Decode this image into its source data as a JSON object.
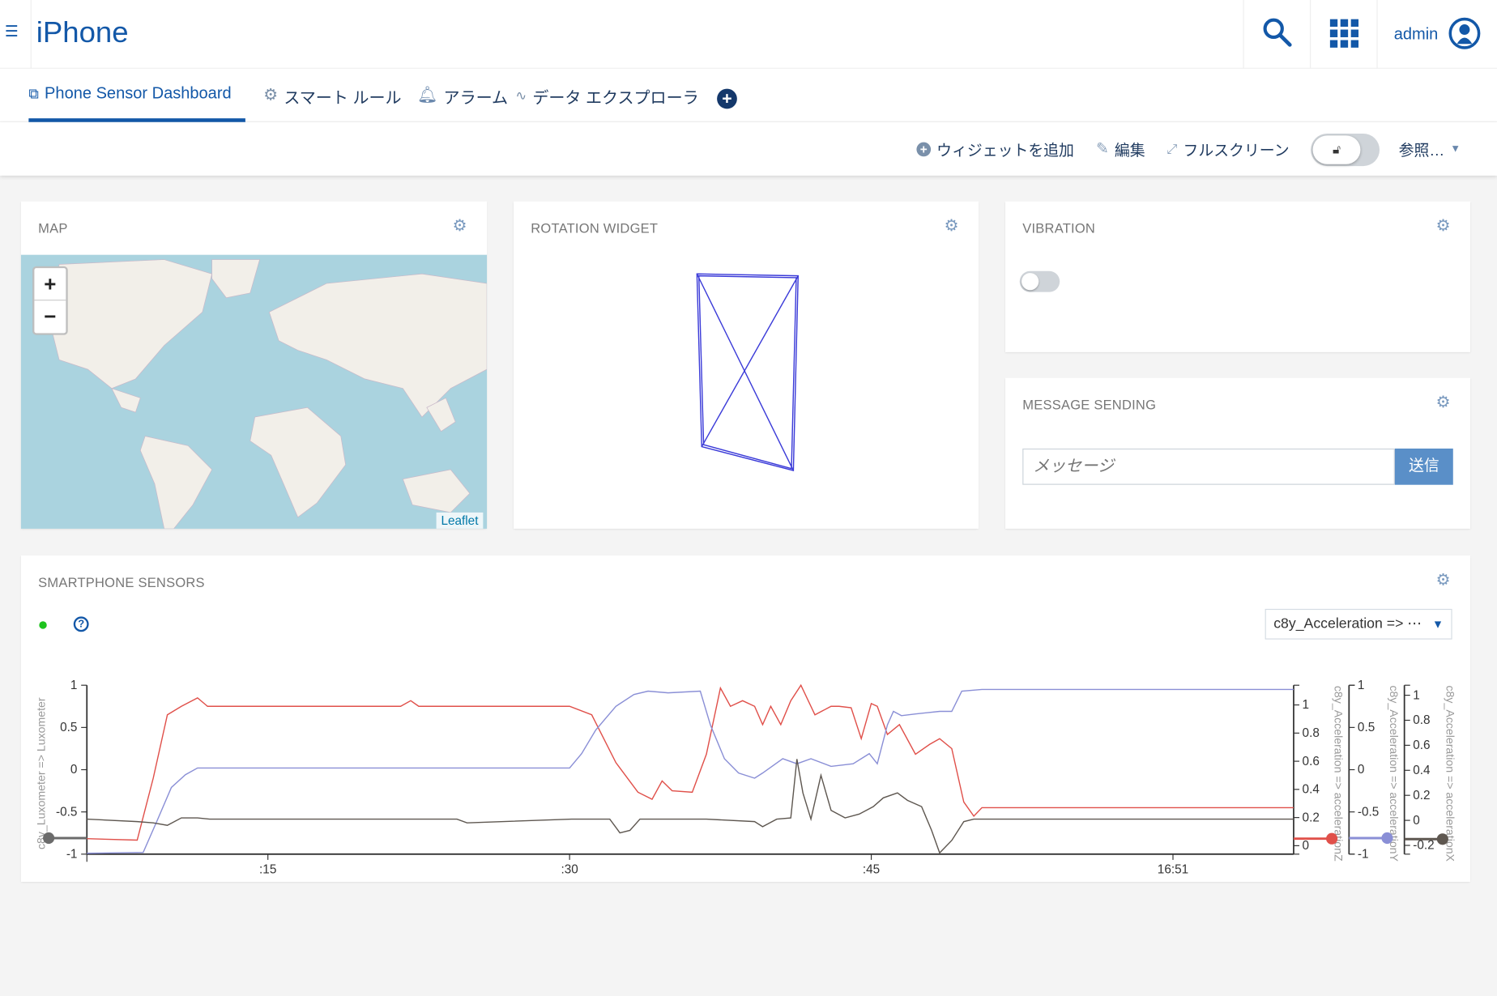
{
  "header": {
    "title": "iPhone",
    "user": "admin",
    "icons": [
      "menu-icon",
      "search-icon",
      "apps-grid-icon",
      "user-avatar-icon"
    ]
  },
  "tabs": [
    {
      "label": "Phone Sensor Dashboard",
      "icon": "devices-icon",
      "active": true
    },
    {
      "label": "スマート ルール",
      "icon": "gears-icon"
    },
    {
      "label": "アラーム",
      "icon": "bell-icon"
    },
    {
      "label": "データ エクスプローラ",
      "icon": "data-explorer-icon"
    }
  ],
  "toolbar": {
    "add_widget": "ウィジェットを追加",
    "edit": "編集",
    "fullscreen": "フルスクリーン",
    "more": "参照…",
    "lock_state": "unlocked"
  },
  "widgets": {
    "map": {
      "title": "MAP",
      "zoom_in": "+",
      "zoom_out": "−",
      "attribution": "Leaflet"
    },
    "rotation": {
      "title": "ROTATION WIDGET"
    },
    "vibration": {
      "title": "VIBRATION",
      "on": false
    },
    "message": {
      "title": "MESSAGE SENDING",
      "placeholder": "メッセージ",
      "send": "送信"
    },
    "sensors": {
      "title": "SMARTPHONE SENSORS",
      "status_color": "#1ec31e",
      "selector": "c8y_Acceleration => ⋯"
    }
  },
  "chart_data": {
    "type": "line",
    "x_ticks": [
      ":15",
      ":30",
      ":45",
      "16:51"
    ],
    "x_tick_times": [
      "16:50:15",
      "16:50:30",
      "16:50:45",
      "16:51:00"
    ],
    "xlim": [
      "16:50:06",
      "16:51:06"
    ],
    "axes": [
      {
        "id": "lux",
        "label": "c8y_Luxometer => Luxometer",
        "side": "left",
        "ylim": [
          -1,
          1
        ],
        "ticks": [
          "1",
          "0.5",
          "0",
          "-0.5",
          "-1"
        ],
        "tick_values": [
          1,
          0.5,
          0,
          -0.5,
          -1
        ],
        "marker": -0.81,
        "color": "#6b6b6b"
      },
      {
        "id": "z",
        "label": "c8y_Acceleration => accelerationZ",
        "side": "right",
        "ylim": [
          -0.06,
          1.14
        ],
        "ticks": [
          "1",
          "0.8",
          "0.6",
          "0.4",
          "0.2",
          "0"
        ],
        "tick_values": [
          1,
          0.8,
          0.6,
          0.4,
          0.2,
          0
        ],
        "marker": 0.05,
        "color": "#e0504a"
      },
      {
        "id": "y",
        "label": "c8y_Acceleration => accelerationY",
        "side": "right",
        "ylim": [
          -1,
          1
        ],
        "ticks": [
          "1",
          "0.5",
          "0",
          "-0.5",
          "-1"
        ],
        "tick_values": [
          1,
          0.5,
          0,
          -0.5,
          -1
        ],
        "marker": -0.81,
        "color": "#8a8fd6"
      },
      {
        "id": "x",
        "label": "c8y_Acceleration => accelerationX",
        "side": "right",
        "ylim": [
          -0.27,
          1.08
        ],
        "ticks": [
          "1",
          "0.8",
          "0.6",
          "0.4",
          "0.2",
          "0",
          "-0.2"
        ],
        "tick_values": [
          1,
          0.8,
          0.6,
          0.4,
          0.2,
          0,
          -0.2
        ],
        "marker": -0.15,
        "color": "#5e5750"
      }
    ],
    "series": [
      {
        "axis": "z",
        "color": "#e0504a",
        "points": [
          [
            "16:50:06.0",
            0.05
          ],
          [
            "16:50:08.5",
            0.04
          ],
          [
            "16:50:09.3",
            0.48
          ],
          [
            "16:50:10.0",
            0.93
          ],
          [
            "16:50:10.7",
            0.99
          ],
          [
            "16:50:11.5",
            1.05
          ],
          [
            "16:50:12.0",
            0.99
          ],
          [
            "16:50:21.6",
            0.99
          ],
          [
            "16:50:22.1",
            1.03
          ],
          [
            "16:50:22.5",
            0.99
          ],
          [
            "16:50:30.0",
            0.99
          ],
          [
            "16:50:31.1",
            0.93
          ],
          [
            "16:50:32.3",
            0.59
          ],
          [
            "16:50:33.4",
            0.38
          ],
          [
            "16:50:34.1",
            0.33
          ],
          [
            "16:50:34.6",
            0.46
          ],
          [
            "16:50:35.1",
            0.39
          ],
          [
            "16:50:36.1",
            0.38
          ],
          [
            "16:50:36.8",
            0.65
          ],
          [
            "16:50:37.5",
            1.12
          ],
          [
            "16:50:38.0",
            0.99
          ],
          [
            "16:50:38.6",
            1.03
          ],
          [
            "16:50:39.2",
            0.99
          ],
          [
            "16:50:39.6",
            0.86
          ],
          [
            "16:50:40.0",
            0.99
          ],
          [
            "16:50:40.5",
            0.86
          ],
          [
            "16:50:41.0",
            1.03
          ],
          [
            "16:50:41.5",
            1.14
          ],
          [
            "16:50:42.2",
            0.93
          ],
          [
            "16:50:43.0",
            0.99
          ],
          [
            "16:50:43.4",
            0.99
          ],
          [
            "16:50:44.0",
            0.98
          ],
          [
            "16:50:44.5",
            0.76
          ],
          [
            "16:50:45.0",
            1.01
          ],
          [
            "16:50:45.3",
            0.99
          ],
          [
            "16:50:45.8",
            0.79
          ],
          [
            "16:50:46.4",
            0.86
          ],
          [
            "16:50:47.2",
            0.65
          ],
          [
            "16:50:47.9",
            0.72
          ],
          [
            "16:50:48.4",
            0.76
          ],
          [
            "16:50:49.0",
            0.69
          ],
          [
            "16:50:49.6",
            0.31
          ],
          [
            "16:50:50.1",
            0.21
          ],
          [
            "16:50:50.5",
            0.27
          ],
          [
            "16:51:06.0",
            0.27
          ]
        ]
      },
      {
        "axis": "y",
        "color": "#8a8fd6",
        "points": [
          [
            "16:50:06.0",
            -0.99
          ],
          [
            "16:50:08.8",
            -0.98
          ],
          [
            "16:50:09.5",
            -0.6
          ],
          [
            "16:50:10.2",
            -0.21
          ],
          [
            "16:50:10.9",
            -0.06
          ],
          [
            "16:50:11.5",
            0.02
          ],
          [
            "16:50:30.0",
            0.02
          ],
          [
            "16:50:30.6",
            0.19
          ],
          [
            "16:50:31.3",
            0.47
          ],
          [
            "16:50:32.3",
            0.75
          ],
          [
            "16:50:33.2",
            0.89
          ],
          [
            "16:50:33.9",
            0.93
          ],
          [
            "16:50:34.9",
            0.91
          ],
          [
            "16:50:36.5",
            0.93
          ],
          [
            "16:50:37.0",
            0.53
          ],
          [
            "16:50:37.7",
            0.13
          ],
          [
            "16:50:38.4",
            -0.04
          ],
          [
            "16:50:39.2",
            -0.1
          ],
          [
            "16:50:39.6",
            -0.04
          ],
          [
            "16:50:40.6",
            0.13
          ],
          [
            "16:50:41.3",
            0.07
          ],
          [
            "16:50:42.0",
            0.13
          ],
          [
            "16:50:43.0",
            0.04
          ],
          [
            "16:50:44.1",
            0.07
          ],
          [
            "16:50:44.9",
            0.19
          ],
          [
            "16:50:45.3",
            0.07
          ],
          [
            "16:50:45.8",
            0.53
          ],
          [
            "16:50:46.1",
            0.69
          ],
          [
            "16:50:46.5",
            0.64
          ],
          [
            "16:50:47.2",
            0.66
          ],
          [
            "16:50:48.4",
            0.69
          ],
          [
            "16:50:49.0",
            0.69
          ],
          [
            "16:50:49.5",
            0.93
          ],
          [
            "16:50:50.5",
            0.95
          ],
          [
            "16:51:06.0",
            0.95
          ]
        ]
      },
      {
        "axis": "x",
        "color": "#5e5750",
        "points": [
          [
            "16:50:06.0",
            0.01
          ],
          [
            "16:50:08.5",
            -0.01
          ],
          [
            "16:50:09.3",
            -0.02
          ],
          [
            "16:50:10.0",
            -0.04
          ],
          [
            "16:50:10.7",
            0.02
          ],
          [
            "16:50:11.5",
            0.02
          ],
          [
            "16:50:12.1",
            0.01
          ],
          [
            "16:50:24.4",
            0.01
          ],
          [
            "16:50:24.9",
            -0.02
          ],
          [
            "16:50:30.1",
            0.01
          ],
          [
            "16:50:32.0",
            0.01
          ],
          [
            "16:50:32.5",
            -0.1
          ],
          [
            "16:50:33.0",
            -0.08
          ],
          [
            "16:50:33.5",
            0.01
          ],
          [
            "16:50:36.8",
            0.01
          ],
          [
            "16:50:39.2",
            -0.01
          ],
          [
            "16:50:39.6",
            -0.05
          ],
          [
            "16:50:40.3",
            0.01
          ],
          [
            "16:50:41.0",
            0.02
          ],
          [
            "16:50:41.3",
            0.49
          ],
          [
            "16:50:41.6",
            0.22
          ],
          [
            "16:50:42.0",
            0.01
          ],
          [
            "16:50:42.5",
            0.36
          ],
          [
            "16:50:43.0",
            0.08
          ],
          [
            "16:50:43.7",
            0.02
          ],
          [
            "16:50:44.4",
            0.05
          ],
          [
            "16:50:45.1",
            0.11
          ],
          [
            "16:50:45.6",
            0.18
          ],
          [
            "16:50:46.3",
            0.22
          ],
          [
            "16:50:46.8",
            0.16
          ],
          [
            "16:50:47.5",
            0.11
          ],
          [
            "16:50:48.0",
            -0.08
          ],
          [
            "16:50:48.4",
            -0.26
          ],
          [
            "16:50:49.0",
            -0.16
          ],
          [
            "16:50:49.6",
            -0.01
          ],
          [
            "16:50:50.1",
            0.01
          ],
          [
            "16:51:06.0",
            0.01
          ]
        ]
      }
    ]
  }
}
